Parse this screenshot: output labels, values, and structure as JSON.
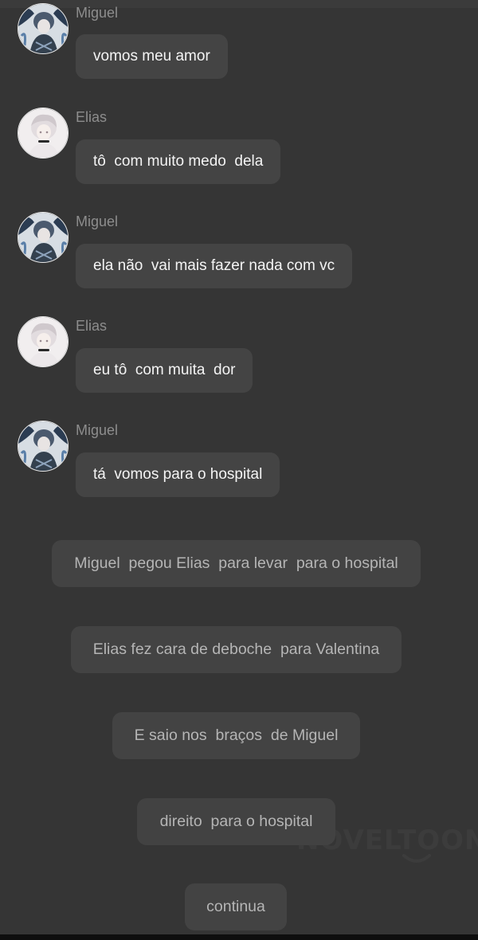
{
  "messages": [
    {
      "sender": "Miguel",
      "text": "vomos meu amor",
      "avatar": "miguel-avatar-icon"
    },
    {
      "sender": "Elias",
      "text": "tô  com muito medo  dela",
      "avatar": "elias-avatar-icon"
    },
    {
      "sender": "Miguel",
      "text": "ela não  vai mais fazer nada com vc",
      "avatar": "miguel-avatar-icon"
    },
    {
      "sender": "Elias",
      "text": "eu tô  com muita  dor",
      "avatar": "elias-avatar-icon"
    },
    {
      "sender": "Miguel",
      "text": "tá  vomos para o hospital",
      "avatar": "miguel-avatar-icon"
    }
  ],
  "narration": [
    "Miguel  pegou Elias  para levar  para o hospital",
    "Elias fez cara de deboche  para Valentina",
    "E saio nos  braços  de Miguel",
    "direito  para o hospital",
    "continua"
  ],
  "watermark": "NOVELTOON",
  "colors": {
    "background": "#353535",
    "bubble": "#444444",
    "bubble_text": "#f4f4f4",
    "sender_text": "#8d8d8d",
    "narration_bg": "#434343",
    "narration_text": "#b5b5b5"
  }
}
